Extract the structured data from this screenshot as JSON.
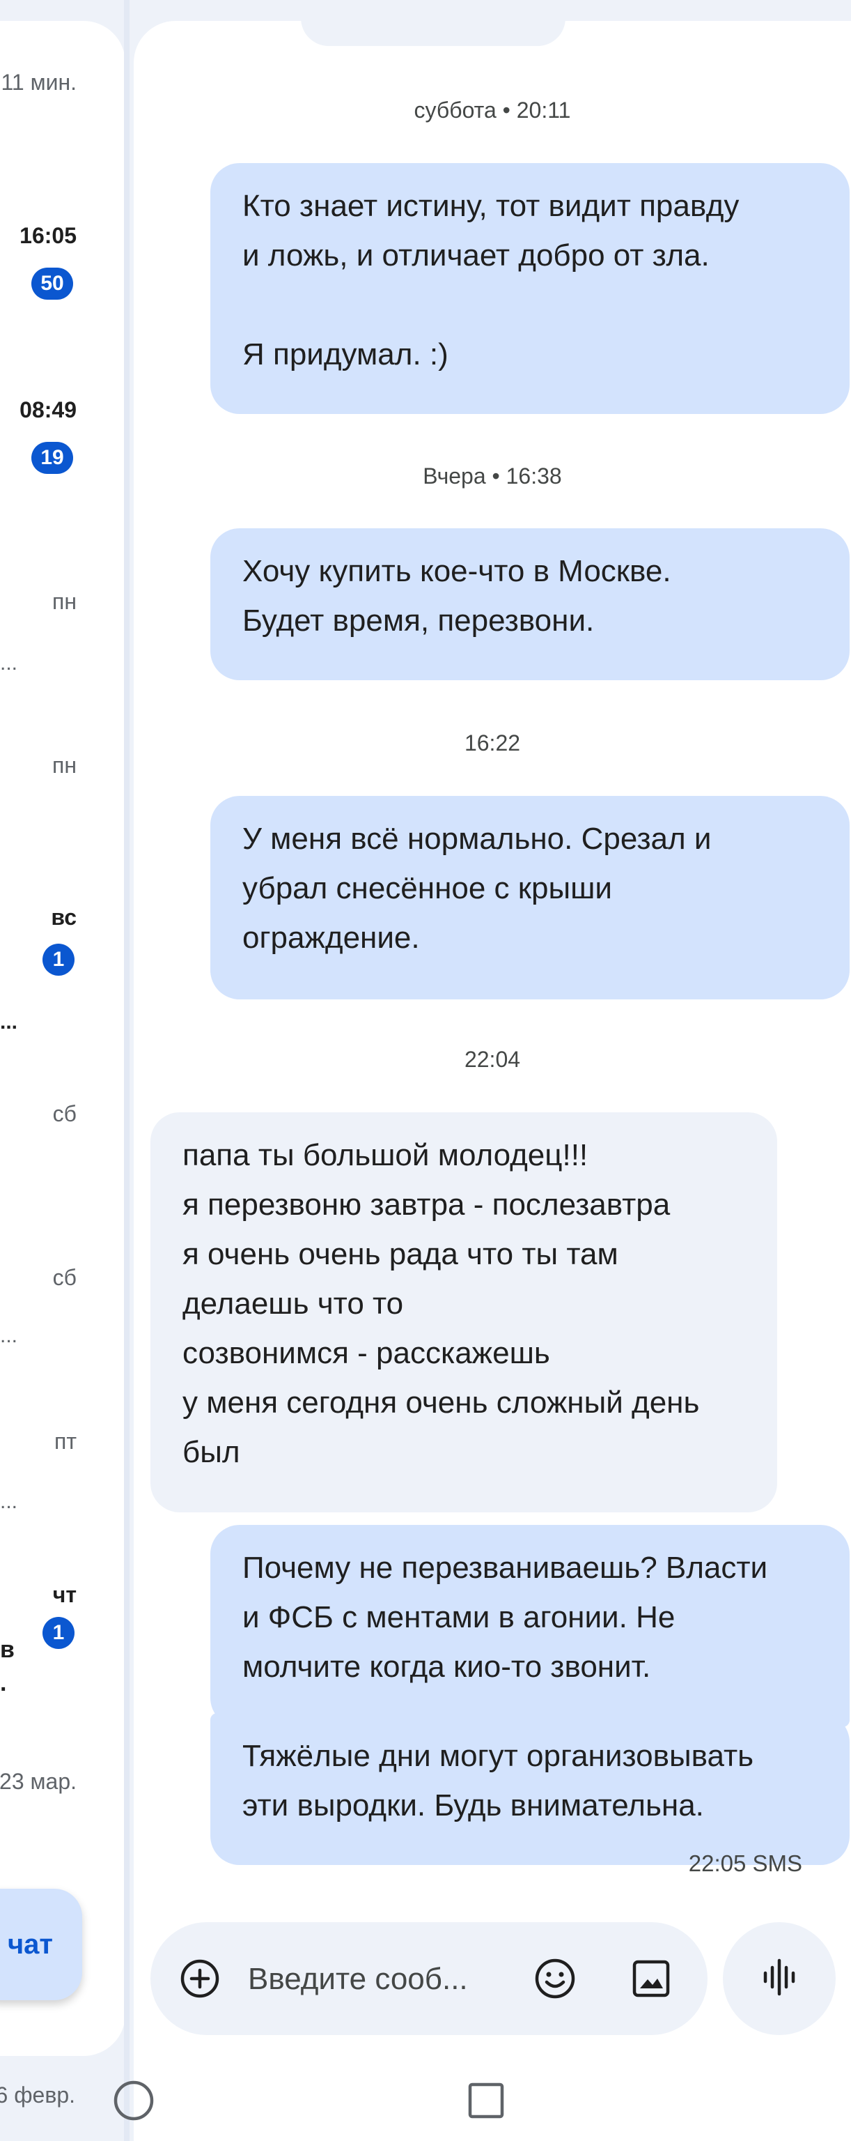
{
  "conversation_list": {
    "items": [
      {
        "time": "11 мин."
      },
      {
        "time": "16:05",
        "unread": "50"
      },
      {
        "time": "08:49",
        "unread": "19"
      },
      {
        "time": "пн"
      },
      {
        "time": "пн"
      },
      {
        "time": "вс",
        "unread": "1"
      },
      {
        "time": "сб"
      },
      {
        "time": "сб"
      },
      {
        "time": "пт"
      },
      {
        "time": "чт",
        "unread": "1",
        "snippet_fragment_1": "в",
        "snippet_fragment_2": "."
      },
      {
        "time": "23 мар."
      },
      {
        "time": "6 февр."
      }
    ],
    "ellipsis": "..."
  },
  "new_chat_button": {
    "label": "чат"
  },
  "conversation": {
    "messages": [
      {
        "type": "separator",
        "text": "суббота • 20:11"
      },
      {
        "type": "outgoing",
        "text": "Кто знает истину, тот видит правду\nи ложь, и отличает добро от зла.\n\nЯ придумал. :)"
      },
      {
        "type": "separator",
        "text": "Вчера • 16:38"
      },
      {
        "type": "outgoing",
        "text": "Хочу купить кое-что в Москве.\nБудет время, перезвони."
      },
      {
        "type": "separator",
        "text": "16:22"
      },
      {
        "type": "outgoing",
        "text": "У меня всё нормально. Срезал и\nубрал снесённое с крыши\nограждение."
      },
      {
        "type": "separator",
        "text": "22:04"
      },
      {
        "type": "incoming",
        "text": "папа ты большой молодец!!!\nя перезвоню завтра - послезавтра\nя очень очень рада что ты там\nделаешь что то\nсозвонимся - расскажешь\nу меня сегодня очень сложный день\nбыл"
      },
      {
        "type": "outgoing",
        "text": "Почему не перезваниваешь? Власти\nи ФСБ с ментами в агонии. Не\nмолчите когда кио-то звонит."
      },
      {
        "type": "outgoing",
        "text": "Тяжёлые дни могут организовывать\nэти выродки. Будь внимательна."
      }
    ],
    "last_status": "22:05 SMS"
  },
  "composer": {
    "placeholder": "Введите сооб..."
  },
  "icons": {
    "add": "add-circle-icon",
    "emoji": "emoji-icon",
    "image": "image-icon",
    "voice": "voice-waveform-icon",
    "home": "nav-home-icon",
    "recents": "nav-recents-icon"
  },
  "colors": {
    "outgoing_bubble": "#d3e3fd",
    "incoming_bubble": "#eef2f9",
    "badge": "#0b57d0",
    "background": "#eef2f9"
  }
}
